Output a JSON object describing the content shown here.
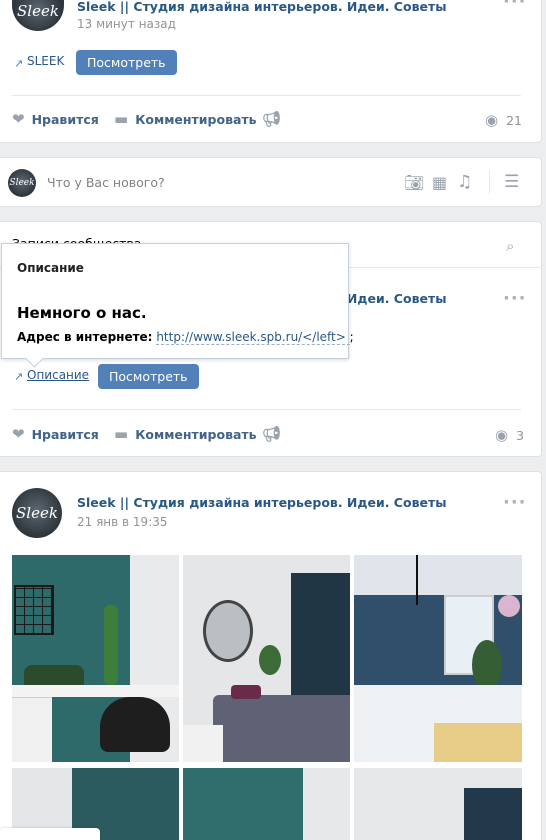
{
  "post1": {
    "date": "13 минут назад",
    "link_label": "SLEEK",
    "button": "Посмотреть",
    "like": "Нравится",
    "comment": "Комментировать",
    "views": "21"
  },
  "composer": {
    "placeholder": "Что у Вас нового?"
  },
  "community": {
    "header": "Записи сообщества"
  },
  "post2": {
    "author": "Sleek || Студия дизайна интерьеров. Идеи. Советы",
    "link_label": "Описание",
    "button": "Посмотреть",
    "like": "Нравится",
    "comment": "Комментировать",
    "views": "3"
  },
  "popup": {
    "title": "Описание",
    "heading": "Немного о нас.",
    "address_label": "Адрес в интернете:",
    "address_value": "http://www.sleek.spb.ru/</left> ",
    "address_tail": ";"
  },
  "post3": {
    "author": "Sleek || Студия дизайна интерьеров. Идеи. Советы",
    "date": "21 янв в 19:35"
  },
  "avatar_text": "Sleek",
  "colors": {
    "accent": "#5181b8",
    "link": "#2a5885",
    "background": "#edeef0"
  },
  "icons": [
    "heart-icon",
    "comment-icon",
    "megaphone-icon",
    "eye-icon",
    "camera-icon",
    "video-icon",
    "music-icon",
    "sort-icon",
    "search-icon",
    "link-icon"
  ]
}
